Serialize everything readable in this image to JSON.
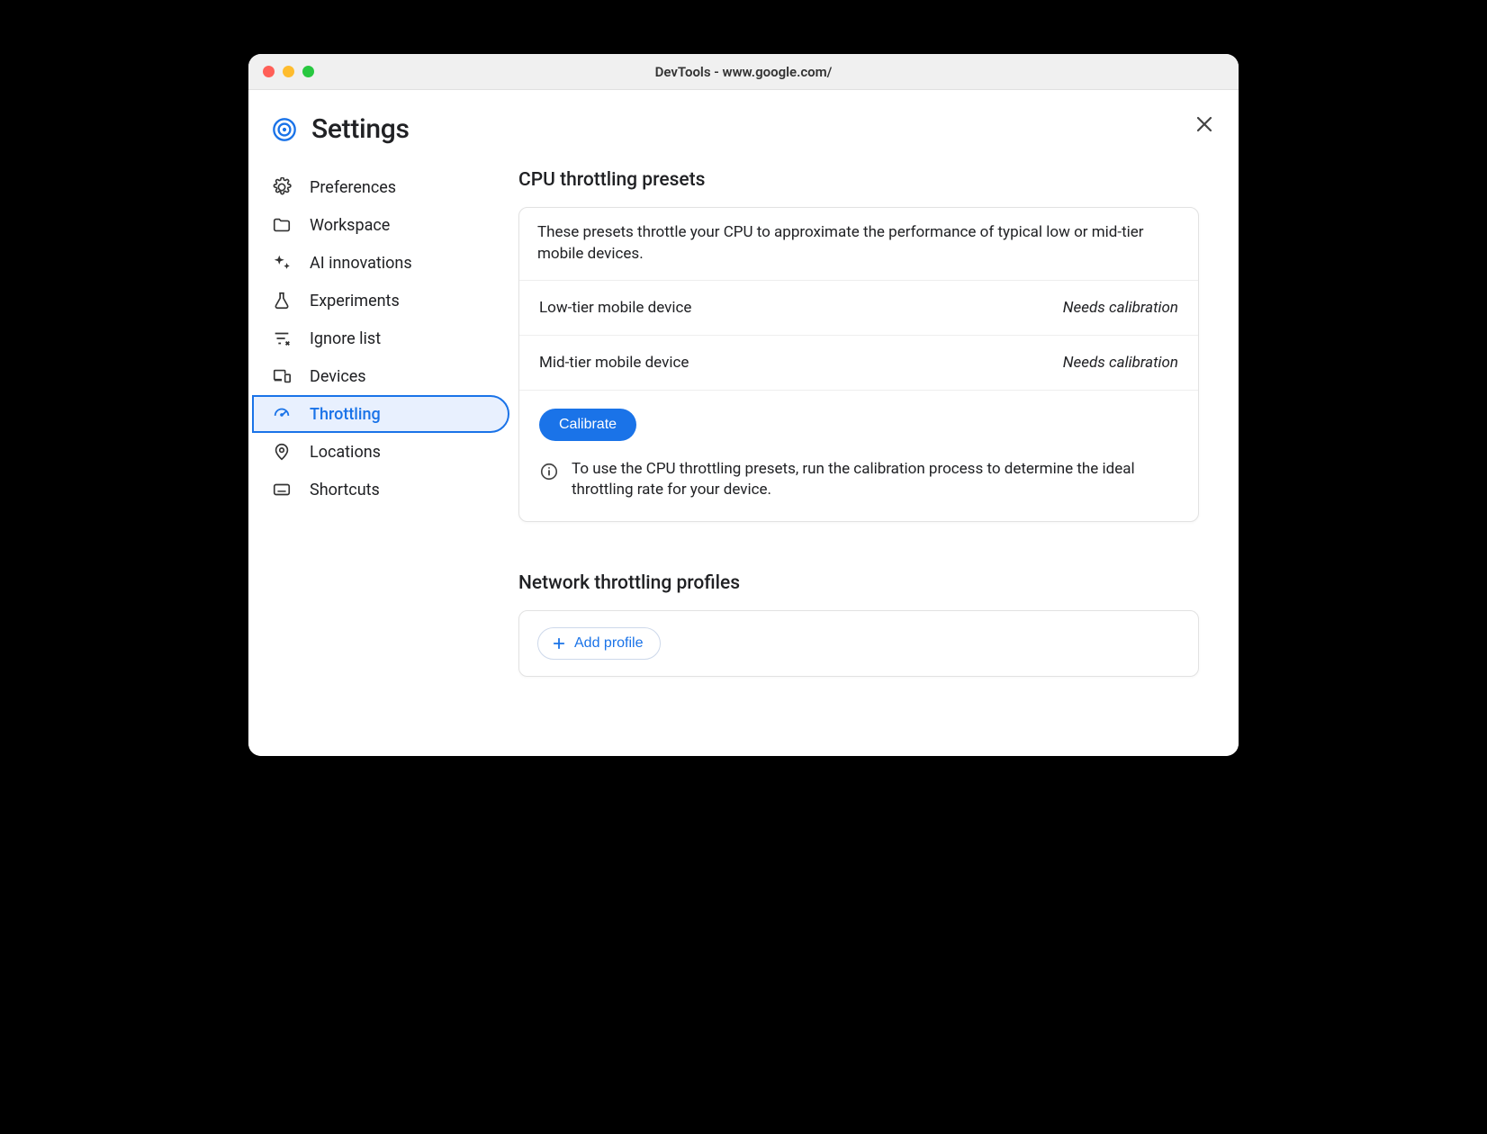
{
  "window": {
    "title": "DevTools - www.google.com/"
  },
  "header": {
    "title": "Settings"
  },
  "sidebar": {
    "items": [
      {
        "label": "Preferences",
        "icon": "gear-icon",
        "active": false
      },
      {
        "label": "Workspace",
        "icon": "folder-icon",
        "active": false
      },
      {
        "label": "AI innovations",
        "icon": "sparkle-icon",
        "active": false
      },
      {
        "label": "Experiments",
        "icon": "flask-icon",
        "active": false
      },
      {
        "label": "Ignore list",
        "icon": "filter-x-icon",
        "active": false
      },
      {
        "label": "Devices",
        "icon": "devices-icon",
        "active": false
      },
      {
        "label": "Throttling",
        "icon": "gauge-icon",
        "active": true
      },
      {
        "label": "Locations",
        "icon": "pin-icon",
        "active": false
      },
      {
        "label": "Shortcuts",
        "icon": "keyboard-icon",
        "active": false
      }
    ]
  },
  "cpu_section": {
    "title": "CPU throttling presets",
    "description": "These presets throttle your CPU to approximate the performance of typical low or mid-tier mobile devices.",
    "presets": [
      {
        "name": "Low-tier mobile device",
        "status": "Needs calibration"
      },
      {
        "name": "Mid-tier mobile device",
        "status": "Needs calibration"
      }
    ],
    "calibrate_label": "Calibrate",
    "info_text": "To use the CPU throttling presets, run the calibration process to determine the ideal throttling rate for your device."
  },
  "network_section": {
    "title": "Network throttling profiles",
    "add_profile_label": "Add profile"
  }
}
